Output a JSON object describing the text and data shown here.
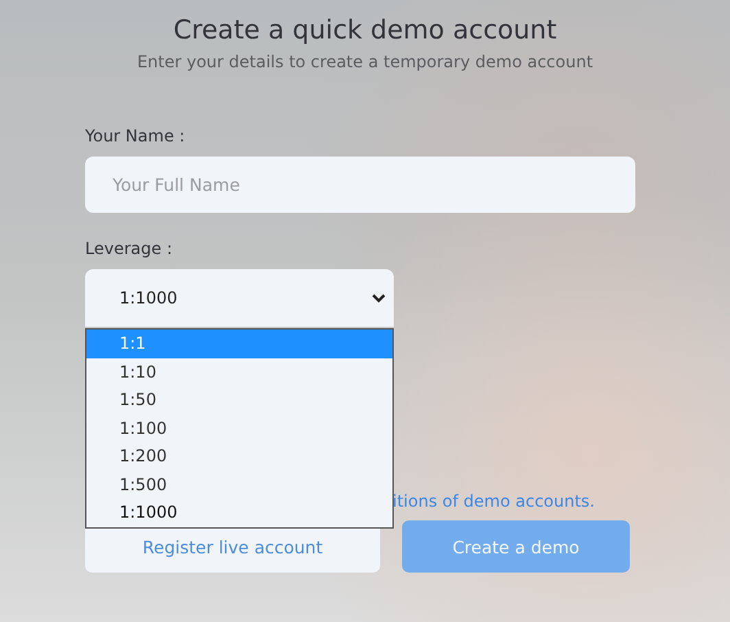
{
  "title": "Create a quick demo account",
  "subtitle": "Enter your details to create a temporary demo account",
  "name_field": {
    "label": "Your Name :",
    "placeholder": "Your Full Name"
  },
  "leverage": {
    "label": "Leverage :",
    "value": "1:1000",
    "expanded": true,
    "options": [
      {
        "label": "1:1",
        "selected": false,
        "highlighted": true
      },
      {
        "label": "1:10",
        "selected": false,
        "highlighted": false
      },
      {
        "label": "1:50",
        "selected": false,
        "highlighted": false
      },
      {
        "label": "1:100",
        "selected": false,
        "highlighted": false
      },
      {
        "label": "1:200",
        "selected": false,
        "highlighted": false
      },
      {
        "label": "1:500",
        "selected": false,
        "highlighted": false
      },
      {
        "label": "1:1000",
        "selected": true,
        "highlighted": false
      }
    ]
  },
  "notice_link": "itions of demo accounts.",
  "buttons": [
    {
      "label": "Register live account",
      "kind": "secondary"
    },
    {
      "label": "Create a demo",
      "kind": "primary"
    }
  ]
}
